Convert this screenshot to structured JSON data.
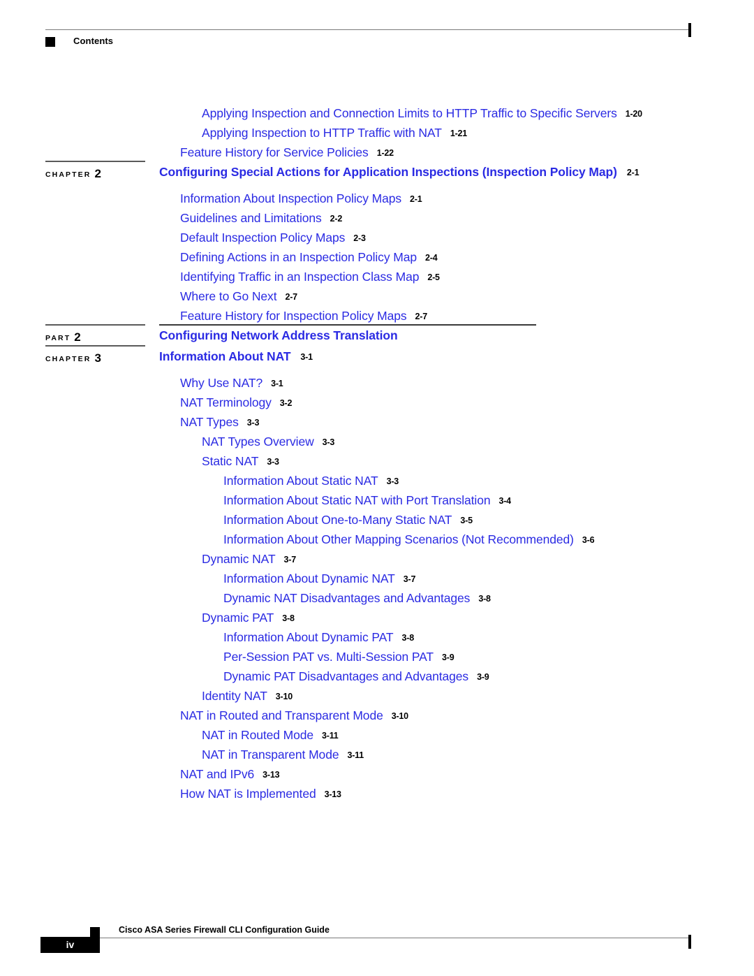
{
  "header": {
    "title": "Contents",
    "marker_icon": "square-marker-icon"
  },
  "footer": {
    "page_number": "iv",
    "document_title": "Cisco ASA Series Firewall CLI Configuration Guide",
    "marker_icon": "square-marker-icon"
  },
  "colors": {
    "link_blue": "#2b2be3",
    "page_number_black": "#000000",
    "rule_gray": "#7a7a7a"
  },
  "toc": {
    "rows": [
      {
        "kind": "entry",
        "level": 2,
        "title": "Applying Inspection and Connection Limits to HTTP Traffic to Specific Servers",
        "page": "1-20"
      },
      {
        "kind": "entry",
        "level": 2,
        "title": "Applying Inspection to HTTP Traffic with NAT",
        "page": "1-21"
      },
      {
        "kind": "entry",
        "level": 1,
        "title": "Feature History for Service Policies",
        "page": "1-22"
      },
      {
        "kind": "chapter",
        "label": "CHAPTER",
        "number": "2",
        "title": "Configuring Special Actions for Application Inspections (Inspection Policy Map)",
        "page": "2-1"
      },
      {
        "kind": "entry",
        "level": 1,
        "title": "Information About Inspection Policy Maps",
        "page": "2-1"
      },
      {
        "kind": "entry",
        "level": 1,
        "title": "Guidelines and Limitations",
        "page": "2-2"
      },
      {
        "kind": "entry",
        "level": 1,
        "title": "Default Inspection Policy Maps",
        "page": "2-3"
      },
      {
        "kind": "entry",
        "level": 1,
        "title": "Defining Actions in an Inspection Policy Map",
        "page": "2-4"
      },
      {
        "kind": "entry",
        "level": 1,
        "title": "Identifying Traffic in an Inspection Class Map",
        "page": "2-5"
      },
      {
        "kind": "entry",
        "level": 1,
        "title": "Where to Go Next",
        "page": "2-7"
      },
      {
        "kind": "entry",
        "level": 1,
        "title": "Feature History for Inspection Policy Maps",
        "page": "2-7"
      },
      {
        "kind": "part",
        "label": "PART",
        "number": "2",
        "title": "Configuring Network Address Translation",
        "page": ""
      },
      {
        "kind": "chapter",
        "label": "CHAPTER",
        "number": "3",
        "title": "Information About NAT",
        "page": "3-1"
      },
      {
        "kind": "entry",
        "level": 1,
        "title": "Why Use NAT?",
        "page": "3-1"
      },
      {
        "kind": "entry",
        "level": 1,
        "title": "NAT Terminology",
        "page": "3-2"
      },
      {
        "kind": "entry",
        "level": 1,
        "title": "NAT Types",
        "page": "3-3"
      },
      {
        "kind": "entry",
        "level": 2,
        "title": "NAT Types Overview",
        "page": "3-3"
      },
      {
        "kind": "entry",
        "level": 2,
        "title": "Static NAT",
        "page": "3-3"
      },
      {
        "kind": "entry",
        "level": 3,
        "title": "Information About Static NAT",
        "page": "3-3"
      },
      {
        "kind": "entry",
        "level": 3,
        "title": "Information About Static NAT with Port Translation",
        "page": "3-4"
      },
      {
        "kind": "entry",
        "level": 3,
        "title": "Information About One-to-Many Static NAT",
        "page": "3-5"
      },
      {
        "kind": "entry",
        "level": 3,
        "title": "Information About Other Mapping Scenarios (Not Recommended)",
        "page": "3-6"
      },
      {
        "kind": "entry",
        "level": 2,
        "title": "Dynamic NAT",
        "page": "3-7"
      },
      {
        "kind": "entry",
        "level": 3,
        "title": "Information About Dynamic NAT",
        "page": "3-7"
      },
      {
        "kind": "entry",
        "level": 3,
        "title": "Dynamic NAT Disadvantages and Advantages",
        "page": "3-8"
      },
      {
        "kind": "entry",
        "level": 2,
        "title": "Dynamic PAT",
        "page": "3-8"
      },
      {
        "kind": "entry",
        "level": 3,
        "title": "Information About Dynamic PAT",
        "page": "3-8"
      },
      {
        "kind": "entry",
        "level": 3,
        "title": "Per-Session PAT vs. Multi-Session PAT",
        "page": "3-9"
      },
      {
        "kind": "entry",
        "level": 3,
        "title": "Dynamic PAT Disadvantages and Advantages",
        "page": "3-9"
      },
      {
        "kind": "entry",
        "level": 2,
        "title": "Identity NAT",
        "page": "3-10"
      },
      {
        "kind": "entry",
        "level": 1,
        "title": "NAT in Routed and Transparent Mode",
        "page": "3-10"
      },
      {
        "kind": "entry",
        "level": 2,
        "title": "NAT in Routed Mode",
        "page": "3-11"
      },
      {
        "kind": "entry",
        "level": 2,
        "title": "NAT in Transparent Mode",
        "page": "3-11"
      },
      {
        "kind": "entry",
        "level": 1,
        "title": "NAT and IPv6",
        "page": "3-13"
      },
      {
        "kind": "entry",
        "level": 1,
        "title": "How NAT is Implemented",
        "page": "3-13"
      }
    ]
  }
}
